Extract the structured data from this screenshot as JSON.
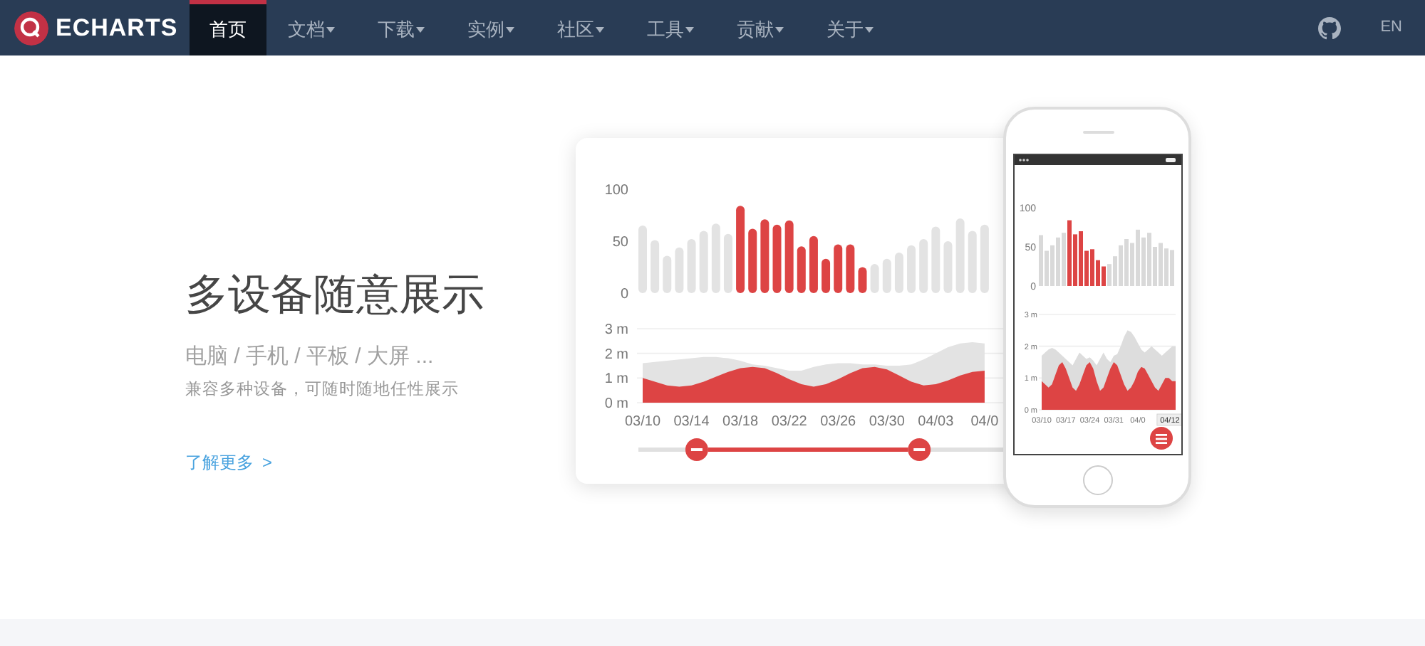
{
  "navbar": {
    "logo": "ECHARTS",
    "items": [
      {
        "label": "首页",
        "dropdown": false,
        "selected": true
      },
      {
        "label": "文档",
        "dropdown": true,
        "selected": false
      },
      {
        "label": "下载",
        "dropdown": true,
        "selected": false
      },
      {
        "label": "实例",
        "dropdown": true,
        "selected": false
      },
      {
        "label": "社区",
        "dropdown": true,
        "selected": false
      },
      {
        "label": "工具",
        "dropdown": true,
        "selected": false
      },
      {
        "label": "贡献",
        "dropdown": true,
        "selected": false
      },
      {
        "label": "关于",
        "dropdown": true,
        "selected": false
      }
    ],
    "language": "EN"
  },
  "hero": {
    "title": "多设备随意展示",
    "subtitle": "电脑 / 手机 / 平板 / 大屏 ...",
    "description": "兼容多种设备，可随时随地任性展示",
    "link": "了解更多",
    "link_arrow": ">"
  },
  "desktop_chart": {
    "bar_chart": {
      "chart_data": {
        "type": "bar",
        "stacked": true,
        "ylim": [
          0,
          100
        ],
        "yticks": [
          0,
          50,
          100
        ],
        "categories": [
          null,
          null,
          null,
          null,
          null,
          null,
          null,
          null,
          null,
          null,
          null,
          null,
          null,
          null,
          null,
          null,
          null,
          null,
          null,
          null,
          null,
          null,
          null,
          null,
          null,
          null,
          null,
          null,
          null
        ],
        "series": [
          {
            "color": "#e3e3e3",
            "values": [
              65,
              51,
              36,
              44,
              52,
              60,
              67,
              57,
              null,
              null,
              null,
              null,
              null,
              null,
              null,
              null,
              null,
              null,
              null,
              28,
              33,
              39,
              46,
              52,
              64,
              50,
              72,
              60,
              66
            ]
          },
          {
            "color": "#dd4444",
            "values": [
              null,
              null,
              null,
              null,
              null,
              null,
              null,
              null,
              84,
              62,
              71,
              66,
              70,
              45,
              55,
              33,
              47,
              47,
              25,
              null,
              null,
              null,
              null,
              null,
              null,
              null,
              null,
              null,
              null
            ]
          }
        ]
      }
    },
    "area_chart": {
      "chart_data": {
        "type": "area",
        "ylim": [
          0,
          3
        ],
        "yticks": [
          {
            "value": 0,
            "label": "0 m"
          },
          {
            "value": 1,
            "label": "1 m"
          },
          {
            "value": 2,
            "label": "2 m"
          },
          {
            "value": 3,
            "label": "3 m"
          }
        ],
        "categories": [
          "03/10",
          null,
          null,
          null,
          "03/14",
          null,
          null,
          null,
          "03/18",
          null,
          null,
          null,
          "03/22",
          null,
          null,
          null,
          "03/26",
          null,
          null,
          null,
          "03/30",
          null,
          null,
          null,
          "04/03",
          null,
          null,
          null,
          "04/0"
        ],
        "series": [
          {
            "color": "#e3e3e3",
            "values": [
              1.6,
              1.65,
              1.7,
              1.75,
              1.8,
              1.85,
              1.85,
              1.8,
              1.7,
              1.55,
              1.5,
              1.4,
              1.3,
              1.3,
              1.45,
              1.55,
              1.6,
              1.6,
              1.55,
              1.55,
              1.5,
              1.5,
              1.55,
              1.75,
              2.0,
              2.25,
              2.4,
              2.45,
              2.4
            ]
          },
          {
            "color": "#dd4444",
            "values": [
              1.0,
              0.85,
              0.7,
              0.65,
              0.7,
              0.85,
              1.05,
              1.25,
              1.4,
              1.45,
              1.4,
              1.2,
              0.95,
              0.75,
              0.65,
              0.75,
              0.95,
              1.2,
              1.4,
              1.45,
              1.35,
              1.1,
              0.85,
              0.7,
              0.75,
              0.9,
              1.1,
              1.25,
              1.3
            ]
          }
        ]
      }
    },
    "zoom_slider": {
      "handles": [
        {
          "level": 0.16
        },
        {
          "level": 0.77
        }
      ]
    }
  },
  "phone": {
    "bar_chart": {
      "chart_data": {
        "type": "bar",
        "stacked": true,
        "ylim": [
          0,
          100
        ],
        "yticks": [
          0,
          50,
          100
        ],
        "categories": [
          null,
          null,
          null,
          null,
          null,
          null,
          null,
          null,
          null,
          null,
          null,
          null,
          null,
          null,
          null,
          null,
          null,
          null,
          null,
          null,
          null,
          null,
          null,
          null
        ],
        "series": [
          {
            "color": "#d9d9d9",
            "values": [
              65,
              45,
              52,
              62,
              68,
              null,
              null,
              null,
              null,
              null,
              null,
              null,
              28,
              38,
              52,
              60,
              55,
              72,
              62,
              68,
              50,
              55,
              48,
              46
            ]
          },
          {
            "color": "#dd4444",
            "values": [
              null,
              null,
              null,
              null,
              null,
              84,
              66,
              70,
              45,
              47,
              33,
              25,
              null,
              null,
              null,
              null,
              null,
              null,
              null,
              null,
              null,
              null,
              null,
              null
            ]
          }
        ]
      }
    },
    "area_chart": {
      "chart_data": {
        "type": "area",
        "ylim": [
          0,
          3
        ],
        "yticks": [
          {
            "value": 0,
            "label": "0 m"
          },
          {
            "value": 1,
            "label": "1 m"
          },
          {
            "value": 2,
            "label": "2 m"
          },
          {
            "value": 3,
            "label": "3 m"
          }
        ],
        "categories": [
          "03/10",
          null,
          null,
          null,
          null,
          null,
          null,
          "03/17",
          null,
          null,
          null,
          null,
          null,
          null,
          "03/24",
          null,
          null,
          null,
          null,
          null,
          null,
          "03/31",
          null,
          null,
          null,
          null,
          null,
          null,
          "04/0",
          null,
          null,
          null,
          null,
          null,
          null,
          null,
          null,
          null,
          null,
          null
        ],
        "series": [
          {
            "color": "#dddddd",
            "values": [
              1.7,
              1.8,
              1.9,
              1.95,
              1.9,
              1.8,
              1.7,
              1.6,
              1.5,
              1.4,
              1.6,
              1.8,
              1.7,
              1.6,
              1.65,
              1.55,
              1.4,
              1.6,
              1.8,
              1.6,
              1.5,
              1.7,
              1.75,
              2.0,
              2.3,
              2.5,
              2.45,
              2.3,
              2.1,
              1.9,
              1.8,
              1.9,
              2.0,
              1.9,
              1.8,
              1.7,
              1.8,
              1.9,
              2.0,
              2.0
            ]
          },
          {
            "color": "#dd4444",
            "values": [
              0.9,
              0.8,
              0.7,
              0.8,
              1.1,
              1.4,
              1.5,
              1.3,
              1.0,
              0.7,
              0.6,
              0.8,
              1.1,
              1.4,
              1.5,
              1.3,
              0.9,
              0.6,
              0.7,
              1.0,
              1.3,
              1.5,
              1.4,
              1.1,
              0.8,
              0.6,
              0.7,
              0.9,
              1.2,
              1.35,
              1.3,
              1.1,
              0.9,
              0.7,
              0.6,
              0.8,
              1.0,
              1.0,
              0.9,
              0.9
            ]
          }
        ]
      }
    },
    "tooltip": "04/12"
  }
}
